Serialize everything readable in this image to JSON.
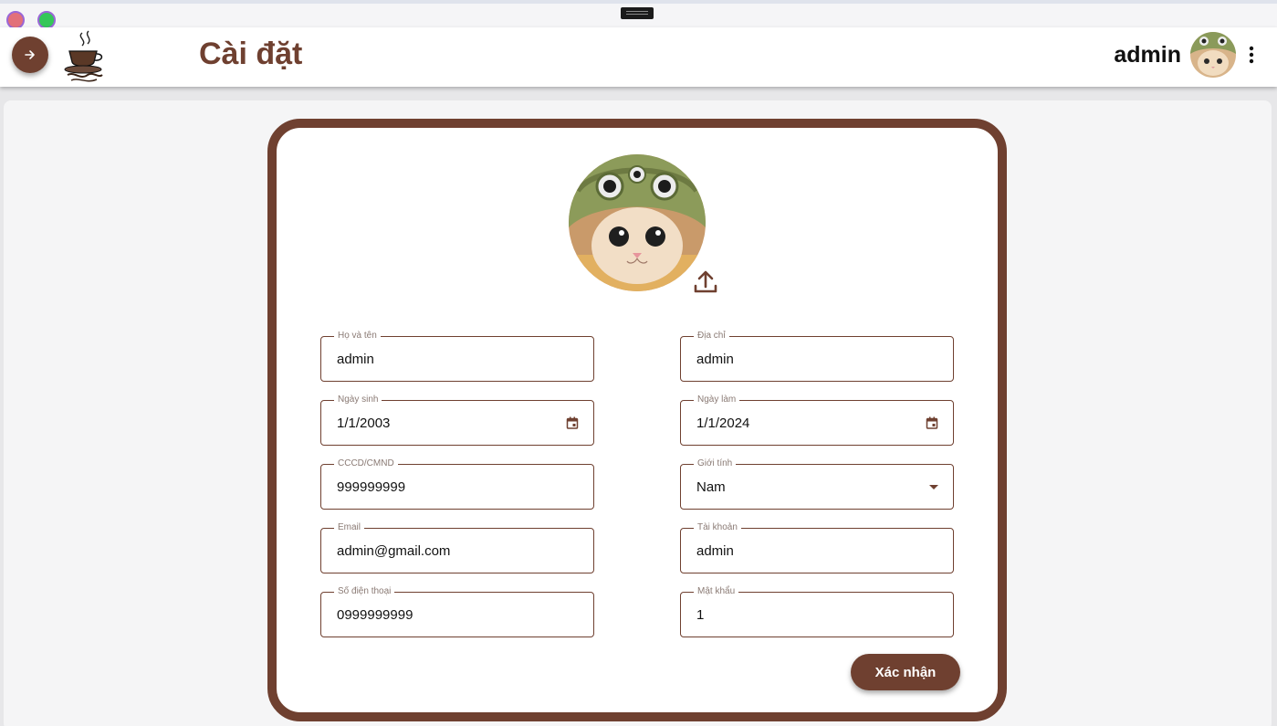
{
  "app": {
    "page_title": "Cài đặt",
    "username": "admin"
  },
  "icons": {
    "nav": "arrow-right-icon",
    "logo": "coffee-cup-logo",
    "more": "more-vertical-icon",
    "upload": "upload-icon",
    "calendar": "calendar-icon",
    "dropdown": "caret-down-icon"
  },
  "colors": {
    "brand": "#6f4030",
    "surface": "#ffffff",
    "background": "#f5f5f6"
  },
  "form": {
    "left": [
      {
        "label": "Họ và tên",
        "value": "admin"
      },
      {
        "label": "Ngày sinh",
        "value": "1/1/2003"
      },
      {
        "label": "CCCD/CMND",
        "value": "999999999"
      },
      {
        "label": "Email",
        "value": "admin@gmail.com"
      },
      {
        "label": "Số điện thoại",
        "value": "0999999999"
      }
    ],
    "right": [
      {
        "label": "Địa chỉ",
        "value": "admin"
      },
      {
        "label": "Ngày làm",
        "value": "1/1/2024"
      },
      {
        "label": "Giới tính",
        "value": "Nam"
      },
      {
        "label": "Tài khoản",
        "value": "admin"
      },
      {
        "label": "Mật khẩu",
        "value": "1"
      }
    ],
    "confirm_label": "Xác nhận"
  }
}
